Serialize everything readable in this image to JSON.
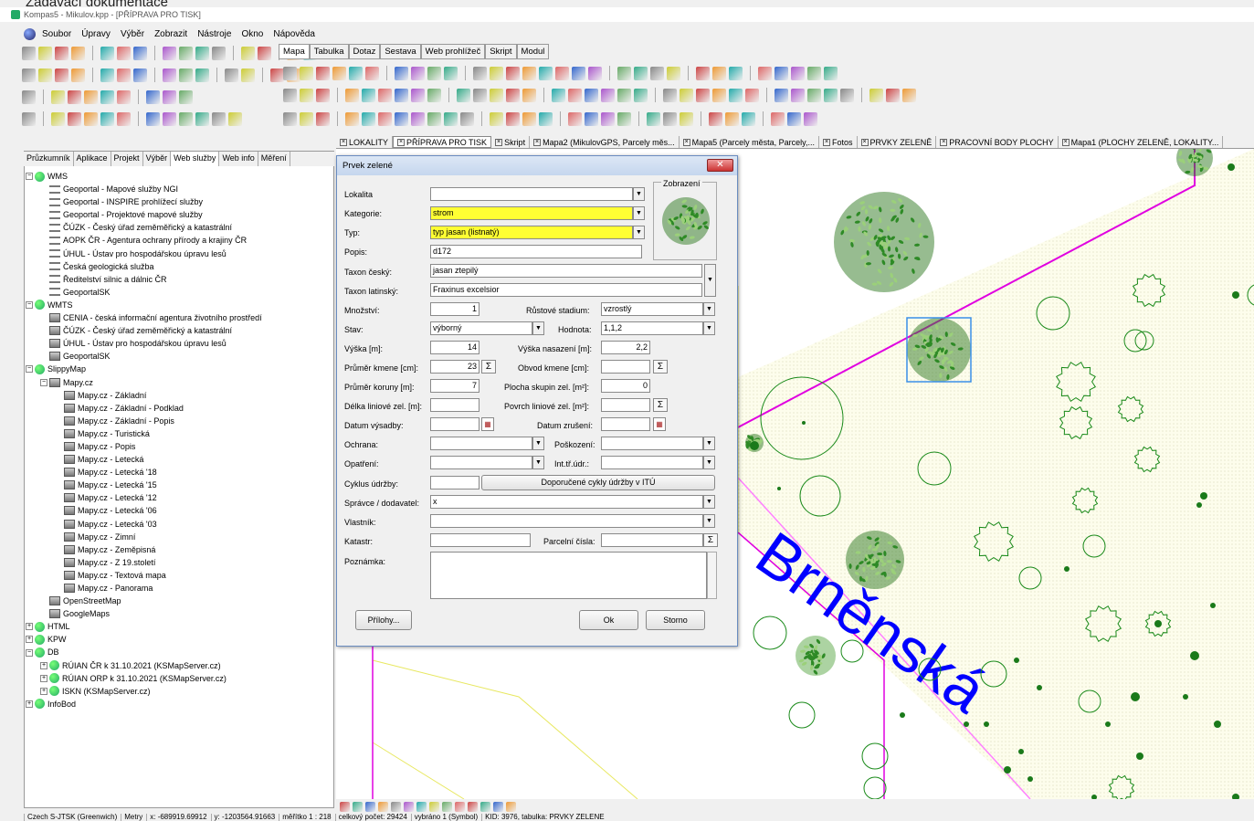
{
  "doc_heading": "Zadávací dokumentace",
  "window_title": "Kompas5 - Mikulov.kpp - [PŘÍPRAVA PRO TISK]",
  "menu": [
    "Soubor",
    "Úpravy",
    "Výběr",
    "Zobrazit",
    "Nástroje",
    "Okno",
    "Nápověda"
  ],
  "ribbon_tabs": [
    "Mapa",
    "Tabulka",
    "Dotaz",
    "Sestava",
    "Web prohlížeč",
    "Skript",
    "Modul"
  ],
  "doc_tabs": [
    "LOKALITY",
    "PŘÍPRAVA PRO TISK",
    "Skript",
    "Mapa2 (MikulovGPS, Parcely měs...",
    "Mapa5 (Parcely města, Parcely,...",
    "Fotos",
    "PRVKY ZELENĚ",
    "PRACOVNÍ BODY PLOCHY",
    "Mapa1 (PLOCHY ZELENĚ, LOKALITY..."
  ],
  "panel_tabs": [
    "Průzkumník",
    "Aplikace",
    "Projekt",
    "Výběr",
    "Web služby",
    "Web info",
    "Měření"
  ],
  "tree": [
    {
      "t": "WMS",
      "lvl": 0,
      "k": "g",
      "pm": "−"
    },
    {
      "t": "Geoportal - Mapové služby NGI",
      "lvl": 1,
      "k": "lay"
    },
    {
      "t": "Geoportal - INSPIRE prohlížecí služby",
      "lvl": 1,
      "k": "lay"
    },
    {
      "t": "Geoportal - Projektové mapové služby",
      "lvl": 1,
      "k": "lay"
    },
    {
      "t": "ČÚZK - Český úřad zeměměřický a katastrální",
      "lvl": 1,
      "k": "lay"
    },
    {
      "t": "AOPK ČR - Agentura ochrany přírody a krajiny ČR",
      "lvl": 1,
      "k": "lay"
    },
    {
      "t": "ÚHUL - Ústav pro hospodářskou úpravu lesů",
      "lvl": 1,
      "k": "lay"
    },
    {
      "t": "Česká geologická služba",
      "lvl": 1,
      "k": "lay"
    },
    {
      "t": "Ředitelství silnic a dálnic ČR",
      "lvl": 1,
      "k": "lay"
    },
    {
      "t": "GeoportalSK",
      "lvl": 1,
      "k": "lay"
    },
    {
      "t": "WMTS",
      "lvl": 0,
      "k": "g",
      "pm": "−"
    },
    {
      "t": "CENIA - česká informační agentura životního prostředí",
      "lvl": 1,
      "k": "ic"
    },
    {
      "t": "ČÚZK - Český úřad zeměměřický a katastrální",
      "lvl": 1,
      "k": "ic"
    },
    {
      "t": "ÚHUL - Ústav pro hospodářskou úpravu lesů",
      "lvl": 1,
      "k": "ic"
    },
    {
      "t": "GeoportalSK",
      "lvl": 1,
      "k": "ic"
    },
    {
      "t": "SlippyMap",
      "lvl": 0,
      "k": "g",
      "pm": "−"
    },
    {
      "t": "Mapy.cz",
      "lvl": 1,
      "k": "ic",
      "pm": "−"
    },
    {
      "t": "Mapy.cz - Základní",
      "lvl": 2,
      "k": "ic"
    },
    {
      "t": "Mapy.cz - Základní - Podklad",
      "lvl": 2,
      "k": "ic"
    },
    {
      "t": "Mapy.cz - Základní - Popis",
      "lvl": 2,
      "k": "ic"
    },
    {
      "t": "Mapy.cz - Turistická",
      "lvl": 2,
      "k": "ic"
    },
    {
      "t": "Mapy.cz - Popis",
      "lvl": 2,
      "k": "ic"
    },
    {
      "t": "Mapy.cz - Letecká",
      "lvl": 2,
      "k": "ic"
    },
    {
      "t": "Mapy.cz - Letecká '18",
      "lvl": 2,
      "k": "ic"
    },
    {
      "t": "Mapy.cz - Letecká '15",
      "lvl": 2,
      "k": "ic"
    },
    {
      "t": "Mapy.cz - Letecká '12",
      "lvl": 2,
      "k": "ic"
    },
    {
      "t": "Mapy.cz - Letecká '06",
      "lvl": 2,
      "k": "ic"
    },
    {
      "t": "Mapy.cz - Letecká '03",
      "lvl": 2,
      "k": "ic"
    },
    {
      "t": "Mapy.cz - Zimní",
      "lvl": 2,
      "k": "ic"
    },
    {
      "t": "Mapy.cz - Zeměpisná",
      "lvl": 2,
      "k": "ic"
    },
    {
      "t": "Mapy.cz - Z 19.století",
      "lvl": 2,
      "k": "ic"
    },
    {
      "t": "Mapy.cz - Textová mapa",
      "lvl": 2,
      "k": "ic"
    },
    {
      "t": "Mapy.cz - Panorama",
      "lvl": 2,
      "k": "ic"
    },
    {
      "t": "OpenStreetMap",
      "lvl": 1,
      "k": "ic"
    },
    {
      "t": "GoogleMaps",
      "lvl": 1,
      "k": "ic"
    },
    {
      "t": "HTML",
      "lvl": 0,
      "k": "g",
      "pm": "+"
    },
    {
      "t": "KPW",
      "lvl": 0,
      "k": "g",
      "pm": "+"
    },
    {
      "t": "DB",
      "lvl": 0,
      "k": "g",
      "pm": "−"
    },
    {
      "t": "RÚIAN ČR k 31.10.2021 (KSMapServer.cz)",
      "lvl": 1,
      "k": "g",
      "pm": "+"
    },
    {
      "t": "RÚIAN ORP k 31.10.2021 (KSMapServer.cz)",
      "lvl": 1,
      "k": "g",
      "pm": "+"
    },
    {
      "t": "ISKN (KSMapServer.cz)",
      "lvl": 1,
      "k": "g",
      "pm": "+"
    },
    {
      "t": "InfoBod",
      "lvl": 0,
      "k": "g",
      "pm": "+"
    }
  ],
  "dialog": {
    "title": "Prvek zelené",
    "close": "✕",
    "preview_label": "Zobrazení",
    "lokalita_label": "Lokalita",
    "lokalita": "",
    "kategorie_label": "Kategorie:",
    "kategorie": "strom",
    "typ_label": "Typ:",
    "typ": "typ jasan (listnatý)",
    "popis_label": "Popis:",
    "popis": "d172",
    "taxon_cesky_label": "Taxon český:",
    "taxon_cesky": "jasan ztepilý",
    "taxon_latinsky_label": "Taxon latinský:",
    "taxon_latinsky": "Fraxinus excelsior",
    "mnozstvi_label": "Množství:",
    "mnozstvi": "1",
    "rustove_label": "Růstové stadium:",
    "rustove": "vzrostlý",
    "stav_label": "Stav:",
    "stav": "výborný",
    "hodnota_label": "Hodnota:",
    "hodnota": "1,1,2",
    "vyska_label": "Výška [m]:",
    "vyska": "14",
    "vyska_nas_label": "Výška nasazení [m]:",
    "vyska_nas": "2,2",
    "prumer_kmene_label": "Průměr kmene [cm]:",
    "prumer_kmene": "23",
    "obvod_label": "Obvod kmene [cm]:",
    "obvod": "",
    "prumer_koruny_label": "Průměr koruny [m]:",
    "prumer_koruny": "7",
    "plocha_label": "Plocha skupin zel. [m²]:",
    "plocha": "0",
    "delka_label": "Délka liniové zel. [m]:",
    "delka": "",
    "povrch_label": "Povrch liniové zel. [m²]:",
    "povrch": "",
    "datum_vys_label": "Datum výsadby:",
    "datum_vys": "",
    "datum_zr_label": "Datum zrušení:",
    "datum_zr": "",
    "ochrana_label": "Ochrana:",
    "ochrana": "",
    "poskozeni_label": "Poškození:",
    "poskozeni": "",
    "opatreni_label": "Opatření:",
    "opatreni": "",
    "int_label": "Int.tř.údr.:",
    "int": "",
    "cyklus_label": "Cyklus údržby:",
    "cyklus": "",
    "doporucene": "Doporučené cykly údržby v ITÚ",
    "spravce_label": "Správce / dodavatel:",
    "spravce": "x",
    "vlastnik_label": "Vlastník:",
    "vlastnik": "",
    "katastr_label": "Katastr:",
    "katastr": "",
    "parcelni_label": "Parcelní čísla:",
    "parcelni": "",
    "poznamka_label": "Poznámka:",
    "poznamka": "",
    "prilohy": "Přílohy...",
    "ok": "Ok",
    "storno": "Storno",
    "sigma": "Σ",
    "arrow": "▼"
  },
  "street_label": "Brněnská",
  "status": [
    "Czech S-JTSK (Greenwich)",
    "Metry",
    "x: -689919.69912",
    "y: -1203564.91663",
    "měřítko 1 : 218",
    "celkový počet: 29424",
    "vybráno 1 (Symbol)",
    "KID: 3976, tabulka: PRVKY ZELENĚ"
  ],
  "colors": {
    "selected": "#ffff33",
    "street": "#0000ff",
    "boundary": "#e000e0",
    "tree": "#3a9a2a",
    "outline": "#1a8a1a"
  }
}
